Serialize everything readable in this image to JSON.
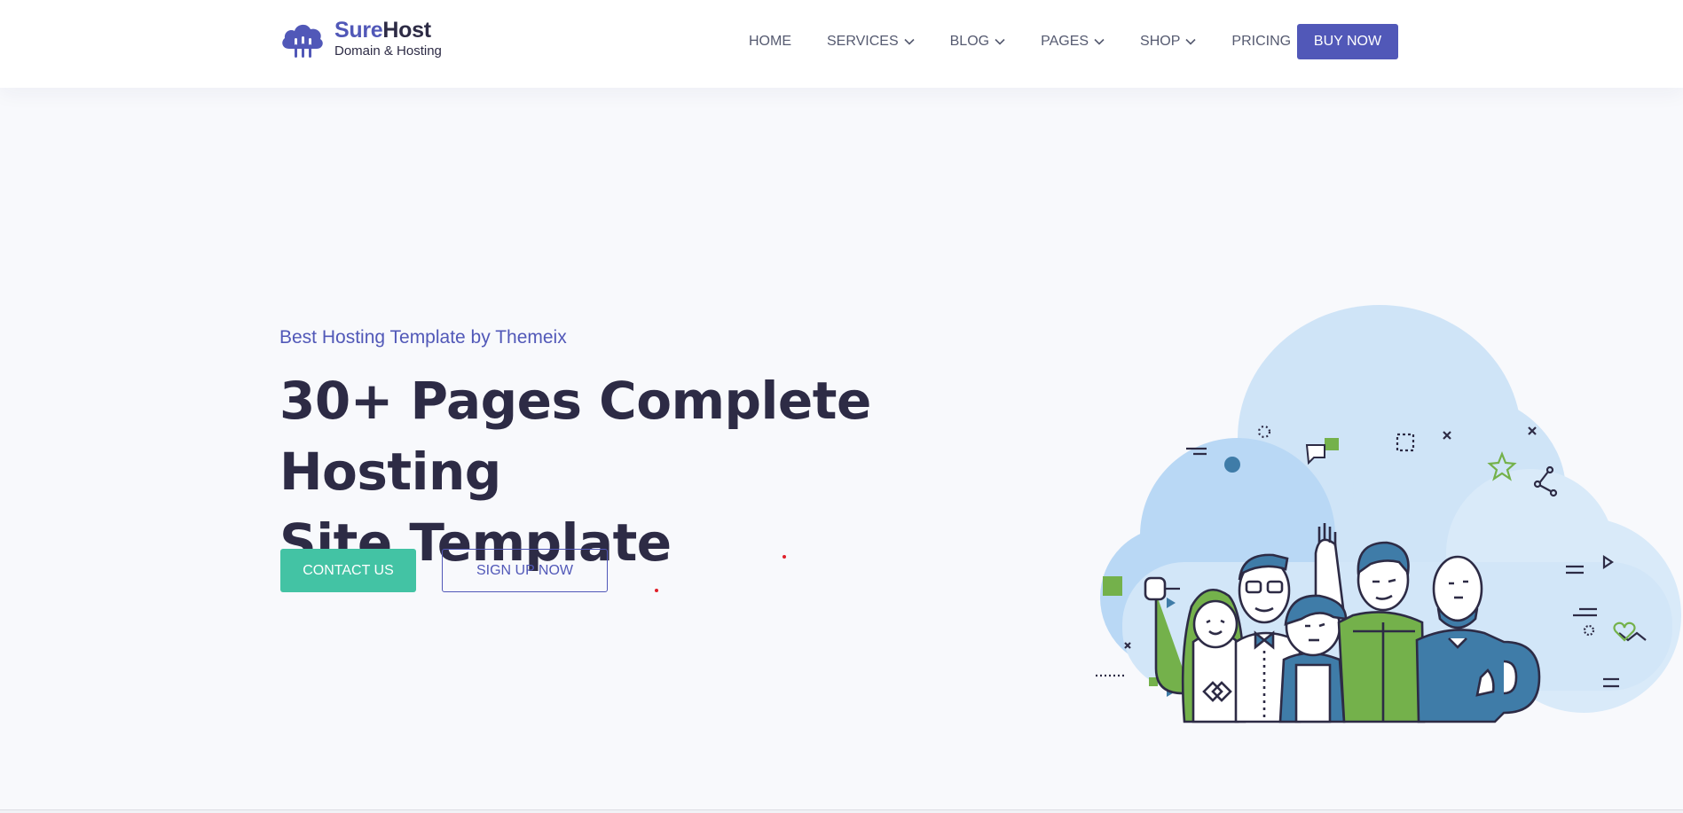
{
  "brand": {
    "name_part1": "Sure",
    "name_part2": "Host",
    "tagline": "Domain & Hosting",
    "primary_color": "#5158b8",
    "accent_color": "#43c3a4"
  },
  "nav": {
    "items": [
      {
        "label": "HOME",
        "has_dropdown": false
      },
      {
        "label": "SERVICES",
        "has_dropdown": true
      },
      {
        "label": "BLOG",
        "has_dropdown": true
      },
      {
        "label": "PAGES",
        "has_dropdown": true
      },
      {
        "label": "SHOP",
        "has_dropdown": true
      },
      {
        "label": "PRICING",
        "has_dropdown": false
      }
    ],
    "cta_label": "BUY NOW"
  },
  "hero": {
    "eyebrow": "Best Hosting Template by Themeix",
    "headline_line1": "30+ Pages Complete Hosting",
    "headline_line2": "Site Template",
    "primary_button": "CONTACT US",
    "secondary_button": "SIGN UP NOW",
    "illustration": "team-of-people-on-cloud-illustration"
  }
}
